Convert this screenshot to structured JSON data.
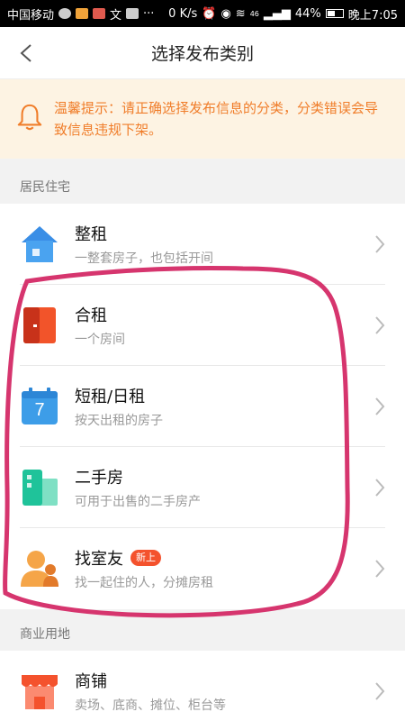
{
  "status_bar": {
    "carrier": "中国移动",
    "speed": "0 K/s",
    "network": "46",
    "battery": "44%",
    "time": "晚上7:05"
  },
  "header": {
    "title": "选择发布类别"
  },
  "notice": {
    "text": "温馨提示：请正确选择发布信息的分类，分类错误会导致信息违规下架。"
  },
  "sections": [
    {
      "title": "居民住宅",
      "items": [
        {
          "title": "整租",
          "subtitle": "一整套房子，也包括开间",
          "icon": "house-icon"
        },
        {
          "title": "合租",
          "subtitle": "一个房间",
          "icon": "door-icon"
        },
        {
          "title": "短租/日租",
          "subtitle": "按天出租的房子",
          "icon": "calendar-icon",
          "icon_text": "7"
        },
        {
          "title": "二手房",
          "subtitle": "可用于出售的二手房产",
          "icon": "building-icon"
        },
        {
          "title": "找室友",
          "subtitle": "找一起住的人，分摊房租",
          "icon": "roommate-icon",
          "badge": "新上"
        }
      ]
    },
    {
      "title": "商业用地",
      "items": [
        {
          "title": "商铺",
          "subtitle": "卖场、底商、摊位、柜台等",
          "icon": "shop-icon"
        }
      ]
    }
  ],
  "colors": {
    "notice_bg": "#fdf3e3",
    "notice_text": "#f07d2a",
    "badge": "#f4522d",
    "annotation": "#d6356e"
  }
}
